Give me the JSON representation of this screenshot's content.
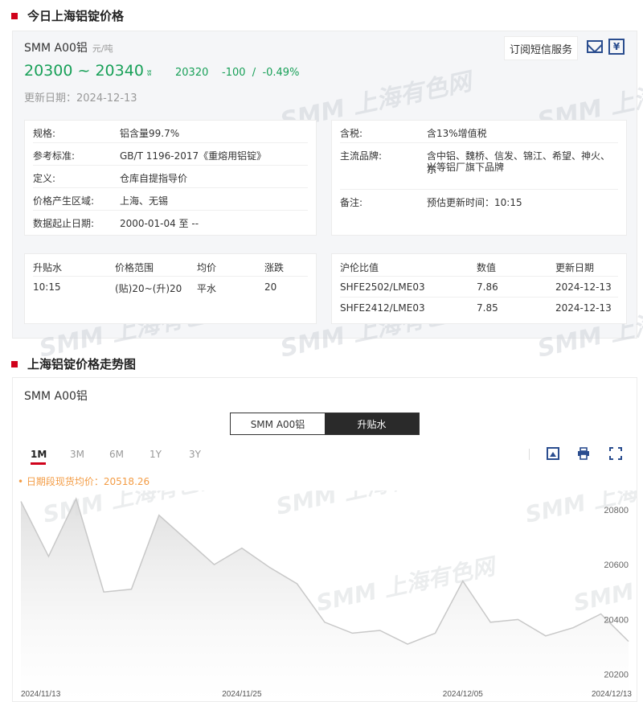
{
  "section1": {
    "title": "今日上海铝锭价格"
  },
  "product": {
    "name": "SMM A00铝",
    "unit": "元/吨",
    "price_low": "20300",
    "tilde": "~",
    "price_high": "20340",
    "trend_mark": "ʬ",
    "avg": "20320",
    "change": "-100",
    "slash": "/",
    "change_pct": "-0.49%",
    "update_label": "更新日期：",
    "update_date": "2024-12-13",
    "subscribe_label": "订阅短信服务",
    "cal_glyph": "¥"
  },
  "watermark": "SMM 上海有色网",
  "specs_left": [
    {
      "k": "规格:",
      "v": "铝含量99.7%"
    },
    {
      "k": "参考标准:",
      "v": "GB/T 1196-2017《重熔用铝锭》"
    },
    {
      "k": "定义:",
      "v": "仓库自提指导价"
    },
    {
      "k": "价格产生区域:",
      "v": "上海、无锡"
    },
    {
      "k": "数据起止日期:",
      "v": "2000-01-04 至 --"
    }
  ],
  "specs_right": [
    {
      "k": "含税:",
      "v": "含13%增值税"
    },
    {
      "k": "主流品牌:",
      "v1": "含中铝、魏桥、信发、锦江、希望、神火、东",
      "v2": "兴等铝厂旗下品牌"
    },
    {
      "k": "备注:",
      "v": "预估更新时间：10:15"
    }
  ],
  "premium_table": {
    "headers": [
      "升贴水",
      "价格范围",
      "均价",
      "涨跌"
    ],
    "row": [
      "10:15",
      "(贴)20~(升)20",
      "平水",
      "20"
    ]
  },
  "ratio_table": {
    "headers": [
      "沪伦比值",
      "数值",
      "更新日期"
    ],
    "rows": [
      [
        "SHFE2502/LME03",
        "7.86",
        "2024-12-13"
      ],
      [
        "SHFE2412/LME03",
        "7.85",
        "2024-12-13"
      ]
    ]
  },
  "section2": {
    "title": "上海铝锭价格走势图"
  },
  "chart_panel": {
    "name": "SMM A00铝",
    "toggle": [
      "SMM A00铝",
      "升贴水"
    ],
    "ranges": [
      "1M",
      "3M",
      "6M",
      "1Y",
      "3Y"
    ],
    "active_range": "1M",
    "avg_label": "• 日期段现货均价：20518.26"
  },
  "colors": {
    "accent_red": "#d0021b",
    "price_green": "#18a058",
    "avg_orange": "#f39c45",
    "icon_blue": "#2a4d8f"
  },
  "chart_data": {
    "type": "area",
    "x": [
      "2024-11-13",
      "2024-11-14",
      "2024-11-15",
      "2024-11-18",
      "2024-11-19",
      "2024-11-20",
      "2024-11-21",
      "2024-11-22",
      "2024-11-25",
      "2024-11-26",
      "2024-11-27",
      "2024-11-28",
      "2024-11-29",
      "2024-12-02",
      "2024-12-03",
      "2024-12-04",
      "2024-12-05",
      "2024-12-06",
      "2024-12-09",
      "2024-12-10",
      "2024-12-11",
      "2024-12-12",
      "2024-12-13"
    ],
    "values": [
      20830,
      20630,
      20840,
      20500,
      20510,
      20780,
      20690,
      20600,
      20660,
      20590,
      20530,
      20390,
      20350,
      20360,
      20310,
      20350,
      20540,
      20390,
      20400,
      20340,
      20370,
      20420,
      20320
    ],
    "x_tick_labels": [
      "2024/11/13",
      "2024/11/25",
      "2024/12/05",
      "2024/12/13"
    ],
    "y_ticks": [
      20200,
      20400,
      20600,
      20800
    ],
    "ylim": [
      20190,
      20870
    ],
    "title": "",
    "xlabel": "",
    "ylabel": "",
    "line_color": "#c8c8c8"
  }
}
